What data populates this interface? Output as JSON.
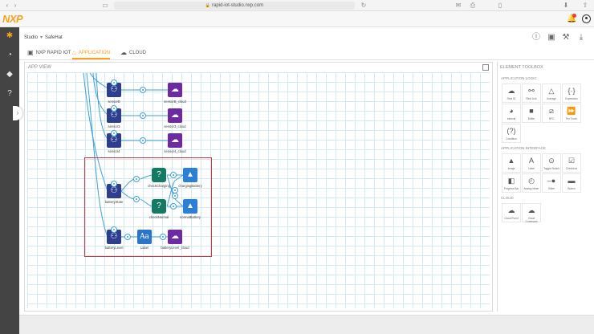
{
  "browser": {
    "url": "rapid-iot-studio.nxp.com",
    "back_icon": "chevron-left-icon",
    "forward_icon": "chevron-right-icon"
  },
  "app": {
    "logo": "NXP",
    "accent_color": "#f7a21b"
  },
  "breadcrumb": {
    "studio": "Studio",
    "project": "SafeHat"
  },
  "tabs": [
    {
      "label": "NXP RAPID IOT",
      "icon": "chip-icon"
    },
    {
      "label": "APPLICATION",
      "icon": "app-icon"
    },
    {
      "label": "CLOUD",
      "icon": "cloud-icon"
    }
  ],
  "app_view": {
    "title": "APP VIEW"
  },
  "nodes": {
    "n1_sensor": "sensorB",
    "n1_cloud": "sensorB_cloud",
    "n2_sensor": "sensor3",
    "n2_cloud": "sensor3_cloud",
    "n3_sensor": "sensor4",
    "n3_cloud": "sensor4_cloud",
    "battery_sensor": "batteryState",
    "cond_charging": "checkCharging",
    "img_charging": "chargingBattery",
    "cond_normal": "checkNormal",
    "img_normal": "normalBattery",
    "level_sensor": "batteryLevel",
    "label_node": "Label",
    "level_cloud": "batteryLevel_cloud"
  },
  "toolbox": {
    "title": "ELEMENT TOOLBOX",
    "sections": [
      {
        "title": "APPLICATION LOGIC",
        "items": [
          {
            "label": "Rest ID",
            "icon": "cloud-icon"
          },
          {
            "label": "Rest Link",
            "icon": "link-icon"
          },
          {
            "label": "Average",
            "icon": "triangle-icon"
          },
          {
            "label": "Expression",
            "icon": "braces-icon"
          },
          {
            "label": "Interval",
            "icon": "pie-icon"
          },
          {
            "label": "Buffer",
            "icon": "cube-icon"
          },
          {
            "label": "NFC",
            "icon": "nfc-icon"
          },
          {
            "label": "Per Touch",
            "icon": "arrows-icon"
          },
          {
            "label": "Condition",
            "icon": "question-icon"
          }
        ]
      },
      {
        "title": "APPLICATION INTERFACE",
        "items": [
          {
            "label": "Image",
            "icon": "image-icon"
          },
          {
            "label": "Label",
            "icon": "text-icon"
          },
          {
            "label": "Toggle Switch",
            "icon": "toggle-icon"
          },
          {
            "label": "Checkbox",
            "icon": "checkbox-icon"
          },
          {
            "label": "Progress Bar",
            "icon": "progress-icon"
          },
          {
            "label": "Analog Meter",
            "icon": "gauge-icon"
          },
          {
            "label": "Slider",
            "icon": "slider-icon"
          },
          {
            "label": "Button",
            "icon": "button-icon"
          }
        ]
      },
      {
        "title": "CLOUD",
        "items": [
          {
            "label": "Cloud Event",
            "icon": "cloud-icon"
          },
          {
            "label": "Cloud Command",
            "icon": "cloud-command-icon"
          }
        ]
      }
    ]
  }
}
